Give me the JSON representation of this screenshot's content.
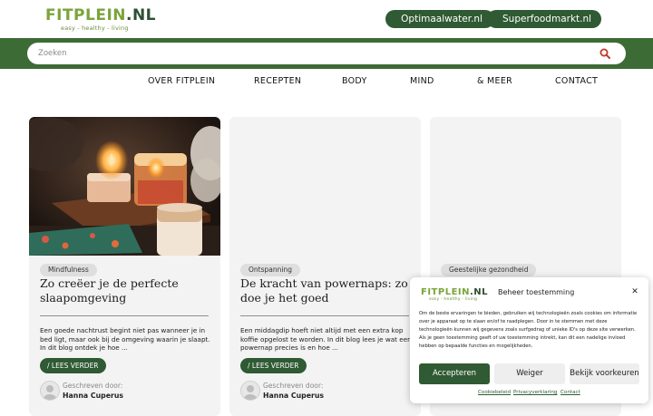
{
  "header": {
    "logo": {
      "name": "FITPLEIN",
      "tld": ".NL",
      "tagline": "easy - healthy - living"
    },
    "shop_links": [
      {
        "label": "Optimaalwater.nl",
        "icon": "cart-icon"
      },
      {
        "label": "Superfoodmarkt.nl",
        "icon": "cart-icon"
      }
    ]
  },
  "search": {
    "placeholder": "Zoeken",
    "value": "",
    "icon": "search-icon"
  },
  "nav": {
    "items": [
      {
        "label": "OVER FITPLEIN"
      },
      {
        "label": "RECEPTEN"
      },
      {
        "label": "BODY"
      },
      {
        "label": "MIND"
      },
      {
        "label": "& MEER"
      },
      {
        "label": "CONTACT"
      }
    ]
  },
  "posts": [
    {
      "category": "Mindfulness",
      "title": "Zo creëer je de perfecte slaapomgeving",
      "excerpt": "Een goede nachtrust begint niet pas wanneer je in bed ligt, maar ook bij de omgeving waarin je slaapt. In dit blog ontdek je hoe ...",
      "cta": "/ LEES VERDER",
      "author_label": "Geschreven door:",
      "author_name": "Hanna Cuperus"
    },
    {
      "category": "Ontspanning",
      "title": "De kracht van powernaps: zo doe je het goed",
      "excerpt": "Een middagdip hoeft niet altijd met een extra kop koffie opgelost te worden. In dit blog lees je wat een powernap precies is en hoe ...",
      "cta": "/ LEES VERDER",
      "author_label": "Geschreven door:",
      "author_name": "Hanna Cuperus"
    },
    {
      "category": "Geestelijke gezondheid"
    }
  ],
  "consent": {
    "logo": {
      "name": "FITPLEIN",
      "tld": ".NL",
      "tagline": "easy - healthy - living"
    },
    "title": "Beheer toestemming",
    "text": "Om de beste ervaringen te bieden, gebruiken wij technologieën zoals cookies om informatie over je apparaat op te slaan en/of te raadplegen. Door in te stemmen met deze technologieën kunnen wij gegevens zoals surfgedrag of unieke ID's op deze site verwerken. Als je geen toestemming geeft of uw toestemming intrekt, kan dit een nadelige invloed hebben op bepaalde functies en mogelijkheden.",
    "buttons": {
      "accept": "Accepteren",
      "deny": "Weiger",
      "preferences": "Bekijk voorkeuren"
    },
    "links": [
      {
        "label": "Cookiebeleid"
      },
      {
        "label": "Privacyverklaring"
      },
      {
        "label": "Contact"
      }
    ]
  },
  "colors": {
    "brand_dark_green": "#2f5a33",
    "search_bar_green": "#3d6b35",
    "logo_light_green": "#7aa43a",
    "accent_red": "#c0392b"
  }
}
